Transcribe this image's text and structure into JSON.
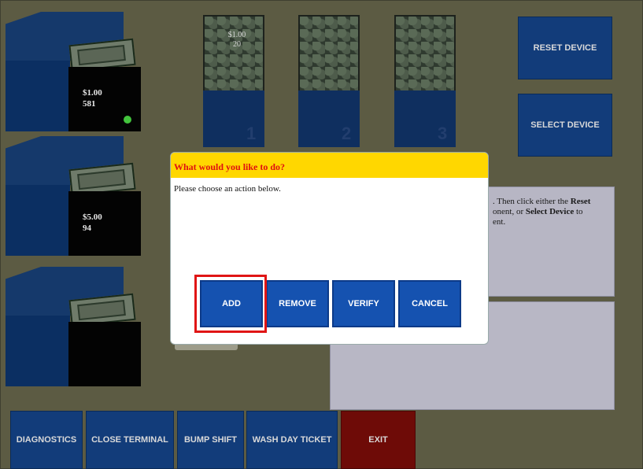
{
  "acceptors": [
    {
      "denom": "$1.00",
      "count": "581",
      "led": "green"
    },
    {
      "denom": "$5.00",
      "count": "94"
    },
    {
      "denom": "",
      "count": ""
    }
  ],
  "hoppers": [
    {
      "denom": "$1.00",
      "count": "20",
      "number": "1"
    },
    {
      "denom": "",
      "count": "",
      "number": "2"
    },
    {
      "denom": "",
      "count": "",
      "number": "3"
    }
  ],
  "side_buttons": {
    "reset": "RESET DEVICE",
    "select": "SELECT DEVICE"
  },
  "info": {
    "line1_prefix": ". Then click either the ",
    "line1_bold": "Reset",
    "line2_prefix": "onent, or ",
    "line2_bold": "Select Device",
    "line2_suffix": " to",
    "line3": "ent."
  },
  "bottom_buttons": {
    "diagnostics": "DIAGNOSTICS",
    "close_terminal": "CLOSE TERMINAL",
    "bump_shift": "BUMP SHIFT",
    "wash_day_ticket": "WASH DAY TICKET",
    "exit": "EXIT"
  },
  "dialog": {
    "title": "What would you like to do?",
    "message": "Please choose an action below.",
    "buttons": {
      "add": "ADD",
      "remove": "REMOVE",
      "verify": "VERIFY",
      "cancel": "CANCEL"
    }
  },
  "colors": {
    "background": "#5c5b43",
    "button_blue": "#123c7a",
    "dialog_button_blue": "#1552b0",
    "exit_red": "#6e0b07",
    "dialog_title_bg": "#ffd700",
    "dialog_title_text": "#e01010",
    "highlight": "#e01515"
  }
}
